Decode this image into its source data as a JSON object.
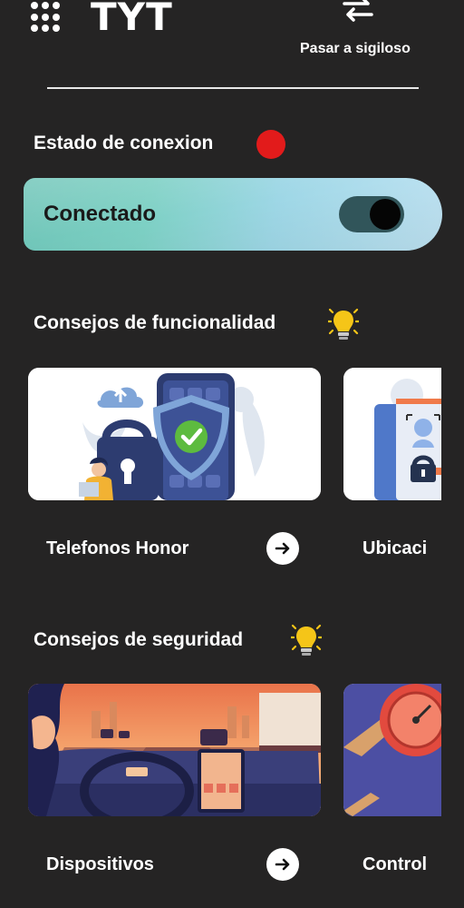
{
  "header": {
    "logo_text": "TYT",
    "stealth_label": "Pasar a sigiloso",
    "menu_icon": "grid-menu-icon",
    "swap_icon": "swap-arrows-icon"
  },
  "connection": {
    "title": "Estado de conexion",
    "status_color": "#e21b1b",
    "status_text": "Conectado",
    "toggle_on": true
  },
  "functionality_tips": {
    "title": "Consejos de funcionalidad",
    "icon": "lightbulb-icon",
    "cards": [
      {
        "label": "Telefonos Honor",
        "image": "phone-security-illustration"
      },
      {
        "label": "Ubicaci",
        "image": "location-lock-illustration"
      }
    ]
  },
  "security_tips": {
    "title": "Consejos de seguridad",
    "icon": "lightbulb-icon",
    "cards": [
      {
        "label": "Dispositivos",
        "image": "car-dashboard-illustration"
      },
      {
        "label": "Control",
        "image": "speedometer-illustration"
      }
    ]
  },
  "colors": {
    "background": "#252424",
    "accent_teal": "#6fc5b8",
    "toggle_track": "#31555a",
    "status_red": "#e21b1b"
  }
}
